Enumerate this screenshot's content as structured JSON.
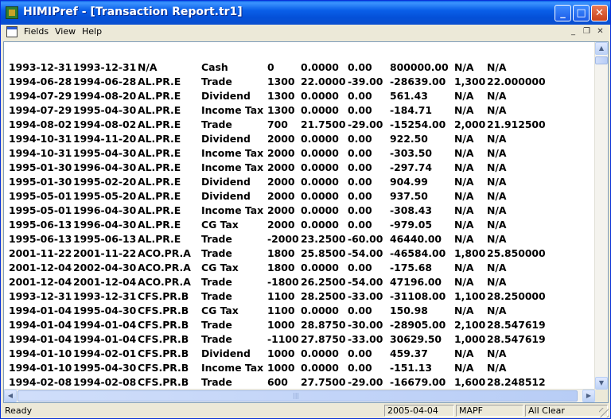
{
  "window": {
    "title": "HIMIPref - [Transaction Report.tr1]"
  },
  "titlebar_buttons": {
    "minimize": "_",
    "maximize": "□",
    "close": "✕"
  },
  "menubar": {
    "items": [
      "Fields",
      "View",
      "Help"
    ],
    "mdi_minimize": "_",
    "mdi_restore": "❐",
    "mdi_close": "✕"
  },
  "report": {
    "rows": [
      [
        "1993-12-31",
        "1993-12-31",
        "N/A",
        "Cash",
        "0",
        "0.0000",
        "0.00",
        "800000.00",
        "N/A",
        "N/A"
      ],
      [
        "1994-06-28",
        "1994-06-28",
        "AL.PR.E",
        "Trade",
        "1300",
        "22.0000",
        "-39.00",
        "-28639.00",
        "1,300",
        "22.000000"
      ],
      [
        "1994-07-29",
        "1994-08-20",
        "AL.PR.E",
        "Dividend",
        "1300",
        "0.0000",
        "0.00",
        "561.43",
        "N/A",
        "N/A"
      ],
      [
        "1994-07-29",
        "1995-04-30",
        "AL.PR.E",
        "Income Tax",
        "1300",
        "0.0000",
        "0.00",
        "-184.71",
        "N/A",
        "N/A"
      ],
      [
        "1994-08-02",
        "1994-08-02",
        "AL.PR.E",
        "Trade",
        "700",
        "21.7500",
        "-29.00",
        "-15254.00",
        "2,000",
        "21.912500"
      ],
      [
        "1994-10-31",
        "1994-11-20",
        "AL.PR.E",
        "Dividend",
        "2000",
        "0.0000",
        "0.00",
        "922.50",
        "N/A",
        "N/A"
      ],
      [
        "1994-10-31",
        "1995-04-30",
        "AL.PR.E",
        "Income Tax",
        "2000",
        "0.0000",
        "0.00",
        "-303.50",
        "N/A",
        "N/A"
      ],
      [
        "1995-01-30",
        "1996-04-30",
        "AL.PR.E",
        "Income Tax",
        "2000",
        "0.0000",
        "0.00",
        "-297.74",
        "N/A",
        "N/A"
      ],
      [
        "1995-01-30",
        "1995-02-20",
        "AL.PR.E",
        "Dividend",
        "2000",
        "0.0000",
        "0.00",
        "904.99",
        "N/A",
        "N/A"
      ],
      [
        "1995-05-01",
        "1995-05-20",
        "AL.PR.E",
        "Dividend",
        "2000",
        "0.0000",
        "0.00",
        "937.50",
        "N/A",
        "N/A"
      ],
      [
        "1995-05-01",
        "1996-04-30",
        "AL.PR.E",
        "Income Tax",
        "2000",
        "0.0000",
        "0.00",
        "-308.43",
        "N/A",
        "N/A"
      ],
      [
        "1995-06-13",
        "1996-04-30",
        "AL.PR.E",
        "CG Tax",
        "2000",
        "0.0000",
        "0.00",
        "-979.05",
        "N/A",
        "N/A"
      ],
      [
        "1995-06-13",
        "1995-06-13",
        "AL.PR.E",
        "Trade",
        "-2000",
        "23.2500",
        "-60.00",
        "46440.00",
        "N/A",
        "N/A"
      ],
      [
        "2001-11-22",
        "2001-11-22",
        "ACO.PR.A",
        "Trade",
        "1800",
        "25.8500",
        "-54.00",
        "-46584.00",
        "1,800",
        "25.850000"
      ],
      [
        "2001-12-04",
        "2002-04-30",
        "ACO.PR.A",
        "CG Tax",
        "1800",
        "0.0000",
        "0.00",
        "-175.68",
        "N/A",
        "N/A"
      ],
      [
        "2001-12-04",
        "2001-12-04",
        "ACO.PR.A",
        "Trade",
        "-1800",
        "26.2500",
        "-54.00",
        "47196.00",
        "N/A",
        "N/A"
      ],
      [
        "1993-12-31",
        "1993-12-31",
        "CFS.PR.B",
        "Trade",
        "1100",
        "28.2500",
        "-33.00",
        "-31108.00",
        "1,100",
        "28.250000"
      ],
      [
        "1994-01-04",
        "1995-04-30",
        "CFS.PR.B",
        "CG Tax",
        "1100",
        "0.0000",
        "0.00",
        "150.98",
        "N/A",
        "N/A"
      ],
      [
        "1994-01-04",
        "1994-01-04",
        "CFS.PR.B",
        "Trade",
        "1000",
        "28.8750",
        "-30.00",
        "-28905.00",
        "2,100",
        "28.547619"
      ],
      [
        "1994-01-04",
        "1994-01-04",
        "CFS.PR.B",
        "Trade",
        "-1100",
        "27.8750",
        "-33.00",
        "30629.50",
        "1,000",
        "28.547619"
      ],
      [
        "1994-01-10",
        "1994-02-01",
        "CFS.PR.B",
        "Dividend",
        "1000",
        "0.0000",
        "0.00",
        "459.37",
        "N/A",
        "N/A"
      ],
      [
        "1994-01-10",
        "1995-04-30",
        "CFS.PR.B",
        "Income Tax",
        "1000",
        "0.0000",
        "0.00",
        "-151.13",
        "N/A",
        "N/A"
      ],
      [
        "1994-02-08",
        "1994-02-08",
        "CFS.PR.B",
        "Trade",
        "600",
        "27.7500",
        "-29.00",
        "-16679.00",
        "1,600",
        "28.248512"
      ]
    ]
  },
  "scrollbar": {
    "up": "▲",
    "down": "▼",
    "left": "◀",
    "right": "▶",
    "grip": "|||"
  },
  "statusbar": {
    "text": "Ready",
    "date": "2005-04-04",
    "mode": "MAPF",
    "status": "All Clear"
  }
}
